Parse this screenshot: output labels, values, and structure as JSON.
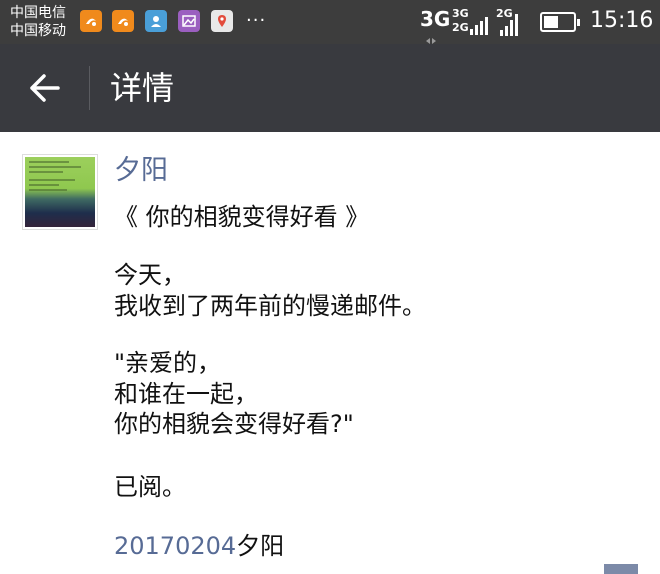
{
  "status_bar": {
    "carrier_1": "中国电信",
    "carrier_2": "中国移动",
    "notification_icons": [
      "uc-browser-icon",
      "uc-browser-icon",
      "contacts-app-icon",
      "gallery-app-icon",
      "maps-app-icon"
    ],
    "more": "···",
    "network_main": "3G",
    "network_sim1": "3G",
    "network_sim1_sub": "2G",
    "network_sim2": "2G",
    "time": "15:16"
  },
  "app_bar": {
    "title": "详情"
  },
  "post": {
    "author": "夕阳",
    "lines": {
      "title": "《 你的相貌变得好看 》",
      "para1": "今天，\n我收到了两年前的慢递邮件。",
      "para2": "\"亲爱的，\n和谁在一起，\n你的相貌会变得好看?\"",
      "para3": "已阅。"
    },
    "signature_date": "20170204",
    "signature_name": "夕阳"
  },
  "colors": {
    "status_bar_bg": "#3d3d3d",
    "app_bar_bg": "#393a3f",
    "link_blue": "#576b95"
  }
}
